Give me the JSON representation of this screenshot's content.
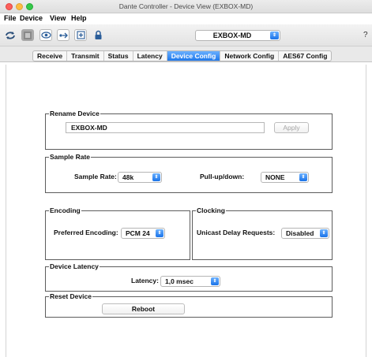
{
  "window": {
    "title": "Dante Controller - Device View (EXBOX-MD)"
  },
  "menu": {
    "items": [
      "File",
      "Device",
      "View",
      "Help"
    ]
  },
  "toolbar": {
    "icons": [
      "refresh-icon",
      "device-info-icon",
      "eye-icon",
      "network-icon",
      "add-window-icon",
      "lock-icon"
    ],
    "device_select": "EXBOX-MD",
    "help": "?"
  },
  "tabs": {
    "items": [
      "Receive",
      "Transmit",
      "Status",
      "Latency",
      "Device Config",
      "Network Config",
      "AES67 Config"
    ],
    "active": "Device Config"
  },
  "rename_device": {
    "title": "Rename Device",
    "value": "EXBOX-MD",
    "apply_label": "Apply"
  },
  "sample_rate": {
    "title": "Sample Rate",
    "rate_label": "Sample Rate:",
    "rate_value": "48k",
    "pull_label": "Pull-up/down:",
    "pull_value": "NONE"
  },
  "encoding": {
    "title": "Encoding",
    "label": "Preferred Encoding:",
    "value": "PCM 24"
  },
  "clocking": {
    "title": "Clocking",
    "label": "Unicast Delay Requests:",
    "value": "Disabled"
  },
  "device_latency": {
    "title": "Device Latency",
    "label": "Latency:",
    "value": "1,0 msec"
  },
  "reset_device": {
    "title": "Reset Device",
    "reboot_label": "Reboot"
  },
  "colors": {
    "accent": "#1f78ea",
    "close": "#fc605c",
    "minimize": "#fdbc40",
    "maximize": "#34c84a"
  }
}
